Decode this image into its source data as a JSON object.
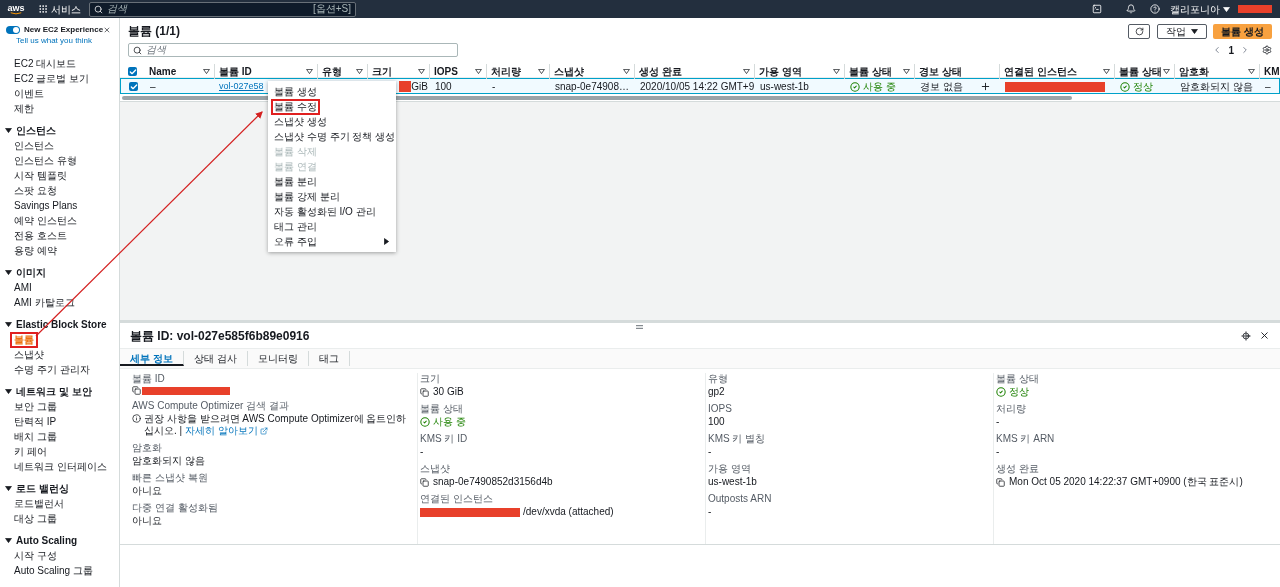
{
  "top_bar": {
    "logo": "aws",
    "services": "서비스",
    "search": {
      "placeholder": "검색",
      "shortcut": "[옵션+S]"
    },
    "region": "캘리포니아"
  },
  "sidebar": {
    "toggle": {
      "label": "New EC2 Experience",
      "on": true
    },
    "feedback_link": "Tell us what you think",
    "items": [
      {
        "label": "EC2 대시보드",
        "selected": false,
        "marked": false
      },
      {
        "label": "EC2 글로벌 보기",
        "selected": false,
        "marked": false
      },
      {
        "label": "이벤트",
        "selected": false,
        "marked": false
      },
      {
        "label": "제한",
        "selected": false,
        "marked": false
      }
    ],
    "sections": [
      {
        "title": "인스턴스",
        "expanded": true,
        "items": [
          {
            "label": "인스턴스",
            "selected": false,
            "marked": false
          },
          {
            "label": "인스턴스 유형",
            "selected": false,
            "marked": false
          },
          {
            "label": "시작 템플릿",
            "selected": false,
            "marked": false
          },
          {
            "label": "스팟 요청",
            "selected": false,
            "marked": false
          },
          {
            "label": "Savings Plans",
            "selected": false,
            "marked": false
          },
          {
            "label": "예약 인스턴스",
            "selected": false,
            "marked": false
          },
          {
            "label": "전용 호스트",
            "selected": false,
            "marked": false
          },
          {
            "label": "용량 예약",
            "selected": false,
            "marked": false
          }
        ]
      },
      {
        "title": "이미지",
        "expanded": true,
        "items": [
          {
            "label": "AMI",
            "selected": false,
            "marked": false
          },
          {
            "label": "AMI 카탈로그",
            "selected": false,
            "marked": false
          }
        ]
      },
      {
        "title": "Elastic Block Store",
        "expanded": true,
        "items": [
          {
            "label": "볼륨",
            "selected": true,
            "marked": true
          },
          {
            "label": "스냅샷",
            "selected": false,
            "marked": false
          },
          {
            "label": "수명 주기 관리자",
            "selected": false,
            "marked": false
          }
        ]
      },
      {
        "title": "네트워크 및 보안",
        "expanded": true,
        "items": [
          {
            "label": "보안 그룹",
            "selected": false,
            "marked": false
          },
          {
            "label": "탄력적 IP",
            "selected": false,
            "marked": false
          },
          {
            "label": "배치 그룹",
            "selected": false,
            "marked": false
          },
          {
            "label": "키 페어",
            "selected": false,
            "marked": false
          },
          {
            "label": "네트워크 인터페이스",
            "selected": false,
            "marked": false
          }
        ]
      },
      {
        "title": "로드 밸런싱",
        "expanded": true,
        "items": [
          {
            "label": "로드밸런서",
            "selected": false,
            "marked": false
          },
          {
            "label": "대상 그룹",
            "selected": false,
            "marked": false
          }
        ]
      },
      {
        "title": "Auto Scaling",
        "expanded": true,
        "items": [
          {
            "label": "시작 구성",
            "selected": false,
            "marked": false
          },
          {
            "label": "Auto Scaling 그룹",
            "selected": false,
            "marked": false
          }
        ]
      }
    ]
  },
  "header": {
    "title": "볼륨 (1/1)",
    "actions_button": "작업",
    "create_button": "볼륨 생성",
    "search_placeholder": "검색",
    "page": "1"
  },
  "table": {
    "columns": [
      {
        "kind": "checkbox",
        "checked": true
      },
      {
        "kind": "label",
        "label": "Name",
        "filter": true
      },
      {
        "kind": "label",
        "label": "볼륨 ID",
        "filter": true
      },
      {
        "kind": "label",
        "label": "유형",
        "filter": true
      },
      {
        "kind": "label",
        "label": "크기",
        "filter": true
      },
      {
        "kind": "label",
        "label": "IOPS",
        "filter": true
      },
      {
        "kind": "label",
        "label": "처리량",
        "filter": true
      },
      {
        "kind": "label",
        "label": "스냅샷",
        "filter": true
      },
      {
        "kind": "label",
        "label": "생성 완료",
        "filter": true
      },
      {
        "kind": "label",
        "label": "가용 영역",
        "filter": true
      },
      {
        "kind": "label",
        "label": "볼륨 상태",
        "filter": true
      },
      {
        "kind": "label",
        "label": "경보 상태",
        "filter": false
      },
      {
        "kind": "label",
        "label": "연결된 인스턴스",
        "filter": true
      },
      {
        "kind": "label",
        "label": "볼륨 상태",
        "filter": true
      },
      {
        "kind": "label",
        "label": "암호화",
        "filter": true
      },
      {
        "kind": "label",
        "label": "KM",
        "filter": false
      }
    ],
    "rows": [
      {
        "selected": true,
        "cells": [
          {
            "kind": "checkbox",
            "checked": true
          },
          {
            "kind": "text",
            "text": "–"
          },
          {
            "kind": "link",
            "text": "vol-027e58"
          },
          {
            "kind": "text",
            "text": ""
          },
          {
            "kind": "size",
            "text": "GiB"
          },
          {
            "kind": "text",
            "text": "100"
          },
          {
            "kind": "text",
            "text": "-"
          },
          {
            "kind": "text",
            "text": "snap-0e74908…"
          },
          {
            "kind": "text",
            "text": "2020/10/05 14:22 GMT+9"
          },
          {
            "kind": "text",
            "text": "us-west-1b"
          },
          {
            "kind": "status",
            "text": "사용 중"
          },
          {
            "kind": "text_add",
            "text": "경보 없음"
          },
          {
            "kind": "redacted"
          },
          {
            "kind": "status",
            "text": "정상"
          },
          {
            "kind": "text",
            "text": "암호화되지 않음"
          },
          {
            "kind": "text",
            "text": "–"
          }
        ]
      }
    ]
  },
  "context_menu": {
    "items": [
      {
        "label": "볼륨 생성",
        "disabled": false,
        "marked": false,
        "submenu": false
      },
      {
        "label": "볼륨 수정",
        "disabled": false,
        "marked": true,
        "submenu": false
      },
      {
        "label": "스냅샷 생성",
        "disabled": false,
        "marked": false,
        "submenu": false
      },
      {
        "label": "스냅샷 수명 주기 정책 생성",
        "disabled": false,
        "marked": false,
        "submenu": false
      },
      {
        "label": "볼륨 삭제",
        "disabled": true,
        "marked": false,
        "submenu": false
      },
      {
        "label": "볼륨 연결",
        "disabled": true,
        "marked": false,
        "submenu": false
      },
      {
        "label": "볼륨 분리",
        "disabled": false,
        "marked": false,
        "submenu": false
      },
      {
        "label": "볼륨 강제 분리",
        "disabled": false,
        "marked": false,
        "submenu": false
      },
      {
        "label": "자동 활성화된 I/O 관리",
        "disabled": false,
        "marked": false,
        "submenu": false
      },
      {
        "label": "태그 관리",
        "disabled": false,
        "marked": false,
        "submenu": false
      },
      {
        "label": "오류 주입",
        "disabled": false,
        "marked": false,
        "submenu": true
      }
    ]
  },
  "details": {
    "title": "볼륨 ID: vol-027e585f6b89e0916",
    "tabs": [
      {
        "label": "세부 정보",
        "selected": true
      },
      {
        "label": "상태 검사",
        "selected": false
      },
      {
        "label": "모니터링",
        "selected": false
      },
      {
        "label": "태그",
        "selected": false
      }
    ],
    "columns": [
      [
        {
          "label": "볼륨 ID",
          "kind": "redacted_copy"
        },
        {
          "label": "AWS Compute Optimizer 검색 결과",
          "kind": "info",
          "value": "권장 사항을 받으려면 AWS Compute Optimizer에 옵트인하십시오. |",
          "link": "자세히 알아보기"
        },
        {
          "label": "암호화",
          "kind": "text",
          "value": "암호화되지 않음"
        },
        {
          "label": "빠른 스냅샷 복원",
          "kind": "text",
          "value": "아니요"
        },
        {
          "label": "다중 연결 활성화됨",
          "kind": "text",
          "value": "아니요"
        }
      ],
      [
        {
          "label": "크기",
          "kind": "copy",
          "value": "30 GiB"
        },
        {
          "label": "볼륨 상태",
          "kind": "status",
          "value": "사용 중"
        },
        {
          "label": "KMS 키 ID",
          "kind": "text",
          "value": "-"
        },
        {
          "label": "스냅샷",
          "kind": "copy",
          "value": "snap-0e7490852d3156d4b"
        },
        {
          "label": "연결된 인스턴스",
          "kind": "redacted_suffix",
          "value": "/dev/xvda (attached)"
        }
      ],
      [
        {
          "label": "유형",
          "kind": "text",
          "value": "gp2"
        },
        {
          "label": "IOPS",
          "kind": "text",
          "value": "100"
        },
        {
          "label": "KMS 키 별칭",
          "kind": "text",
          "value": "-"
        },
        {
          "label": "가용 영역",
          "kind": "text",
          "value": "us-west-1b"
        },
        {
          "label": "Outposts ARN",
          "kind": "text",
          "value": "-"
        }
      ],
      [
        {
          "label": "볼륨 상태",
          "kind": "status",
          "value": "정상"
        },
        {
          "label": "처리량",
          "kind": "text",
          "value": "-"
        },
        {
          "label": "KMS 키 ARN",
          "kind": "text",
          "value": "-"
        },
        {
          "label": "생성 완료",
          "kind": "copy",
          "value": "Mon Oct 05 2020 14:22:37 GMT+0900 (한국 표준시)"
        }
      ]
    ]
  }
}
